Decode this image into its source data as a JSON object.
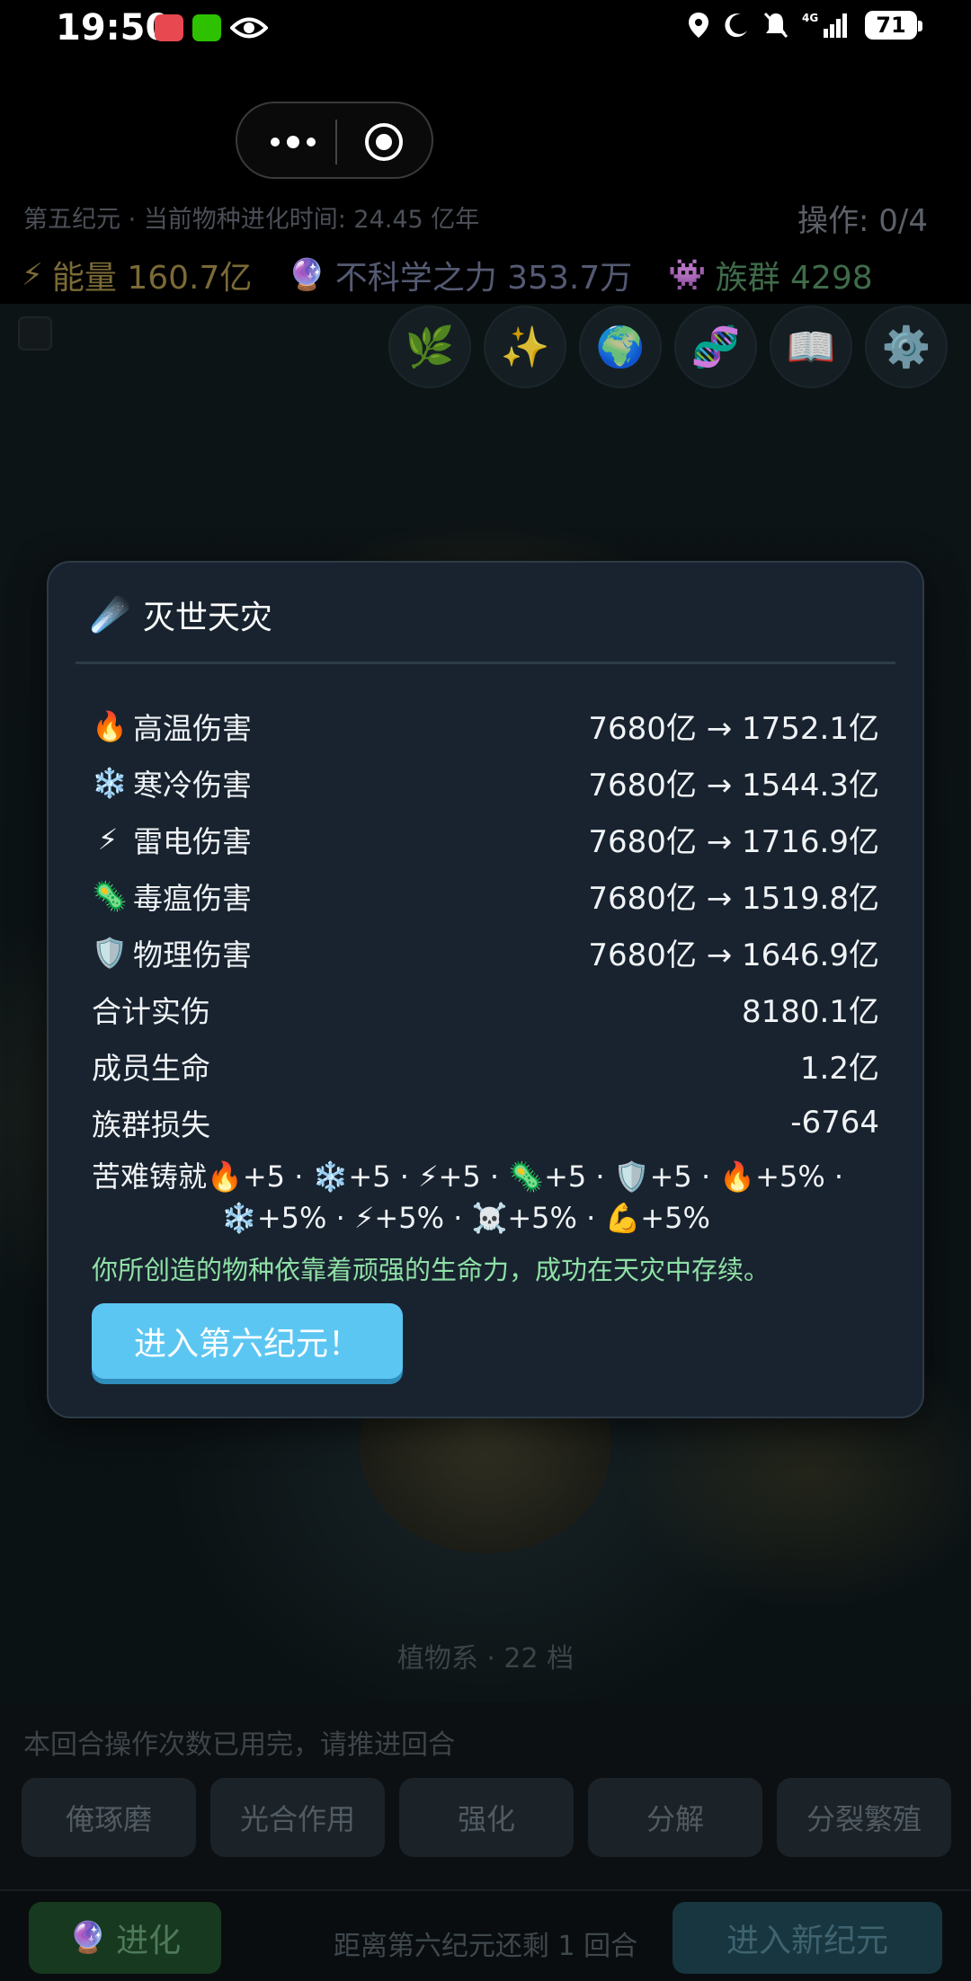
{
  "status_bar": {
    "time": "19:50",
    "battery": "71",
    "network": "4G"
  },
  "header": {
    "era_info": "第五纪元 · 当前物种进化时间: 24.45 亿年",
    "ops": "操作: 0/4",
    "resources": {
      "energy": "能量 160.7亿",
      "power": "不科学之力 353.7万",
      "clan": "族群 4298"
    }
  },
  "toolbar_icons": [
    "plant-icon",
    "sparkles-icon",
    "globe-icon",
    "dna-icon",
    "book-icon",
    "gear-icon"
  ],
  "game": {
    "faction_label": "植物系 · 22 档"
  },
  "modal": {
    "title": "灭世天灾",
    "rows": [
      {
        "icon": "🔥",
        "label": "高温伤害",
        "value": "7680亿 → 1752.1亿"
      },
      {
        "icon": "❄️",
        "label": "寒冷伤害",
        "value": "7680亿 → 1544.3亿"
      },
      {
        "icon": "⚡",
        "label": "雷电伤害",
        "value": "7680亿 → 1716.9亿"
      },
      {
        "icon": "🦠",
        "label": "毒瘟伤害",
        "value": "7680亿 → 1519.8亿"
      },
      {
        "icon": "🛡️",
        "label": "物理伤害",
        "value": "7680亿 → 1646.9亿"
      },
      {
        "icon": "",
        "label": "合计实伤",
        "value": "8180.1亿"
      },
      {
        "icon": "",
        "label": "成员生命",
        "value": "1.2亿"
      },
      {
        "icon": "",
        "label": "族群损失",
        "value": "-6764"
      }
    ],
    "bonus_label": "苦难铸就",
    "bonus_line1": "🔥+5 · ❄️+5 · ⚡+5 · 🦠+5 · 🛡️+5 · 🔥+5% ·",
    "bonus_line2": "❄️+5% · ⚡+5% · ☠️+5% · 💪+5%",
    "survive_text": "你所创造的物种依靠着顽强的生命力，成功在天灾中存续。",
    "enter_button": "进入第六纪元！"
  },
  "bottom": {
    "tip": "本回合操作次数已用完，请推进回合",
    "actions": [
      "俺琢磨",
      "光合作用",
      "强化",
      "分解",
      "分裂繁殖"
    ],
    "evolve": "进化",
    "remain": "距离第六纪元还剩 1 回合",
    "new_era": "进入新纪元"
  }
}
